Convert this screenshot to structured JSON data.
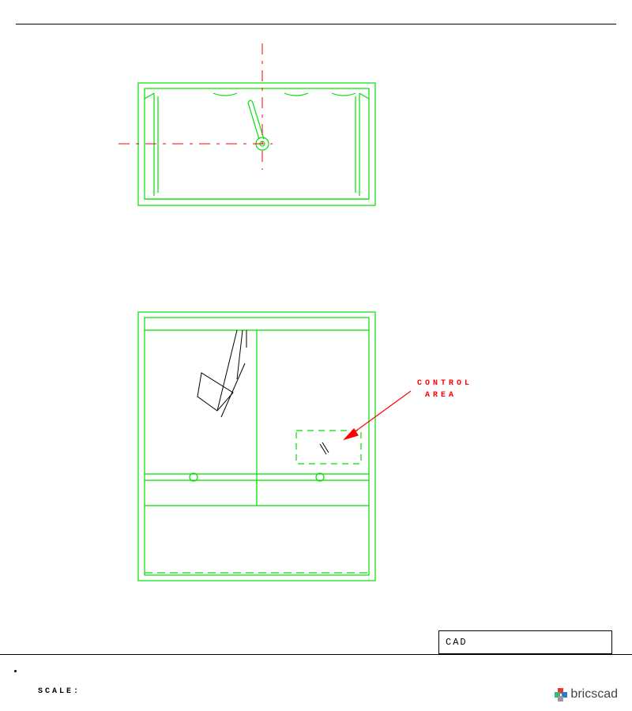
{
  "annotation": {
    "line1": "CONTROL",
    "line2": "AREA"
  },
  "title_block": {
    "label": "CAD"
  },
  "footer": {
    "scale_label": "SCALE:"
  },
  "brand": {
    "name": "bricscad"
  },
  "colors": {
    "cad_green": "#00e000",
    "cad_red": "#ff0000",
    "black": "#000000"
  }
}
